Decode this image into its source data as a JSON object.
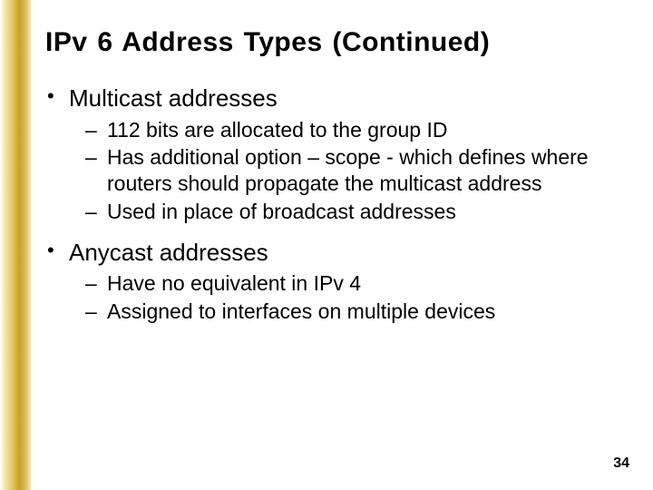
{
  "slide": {
    "title": "IPv 6 Address Types (Continued)",
    "bullets": [
      {
        "text": "Multicast addresses",
        "sub": [
          "112 bits are allocated to the group ID",
          "Has additional option – scope - which defines where routers should propagate the multicast address",
          "Used in place of broadcast addresses"
        ]
      },
      {
        "text": "Anycast addresses",
        "sub": [
          "Have no equivalent in IPv 4",
          "Assigned to interfaces on multiple devices"
        ]
      }
    ],
    "page_number": "34"
  }
}
